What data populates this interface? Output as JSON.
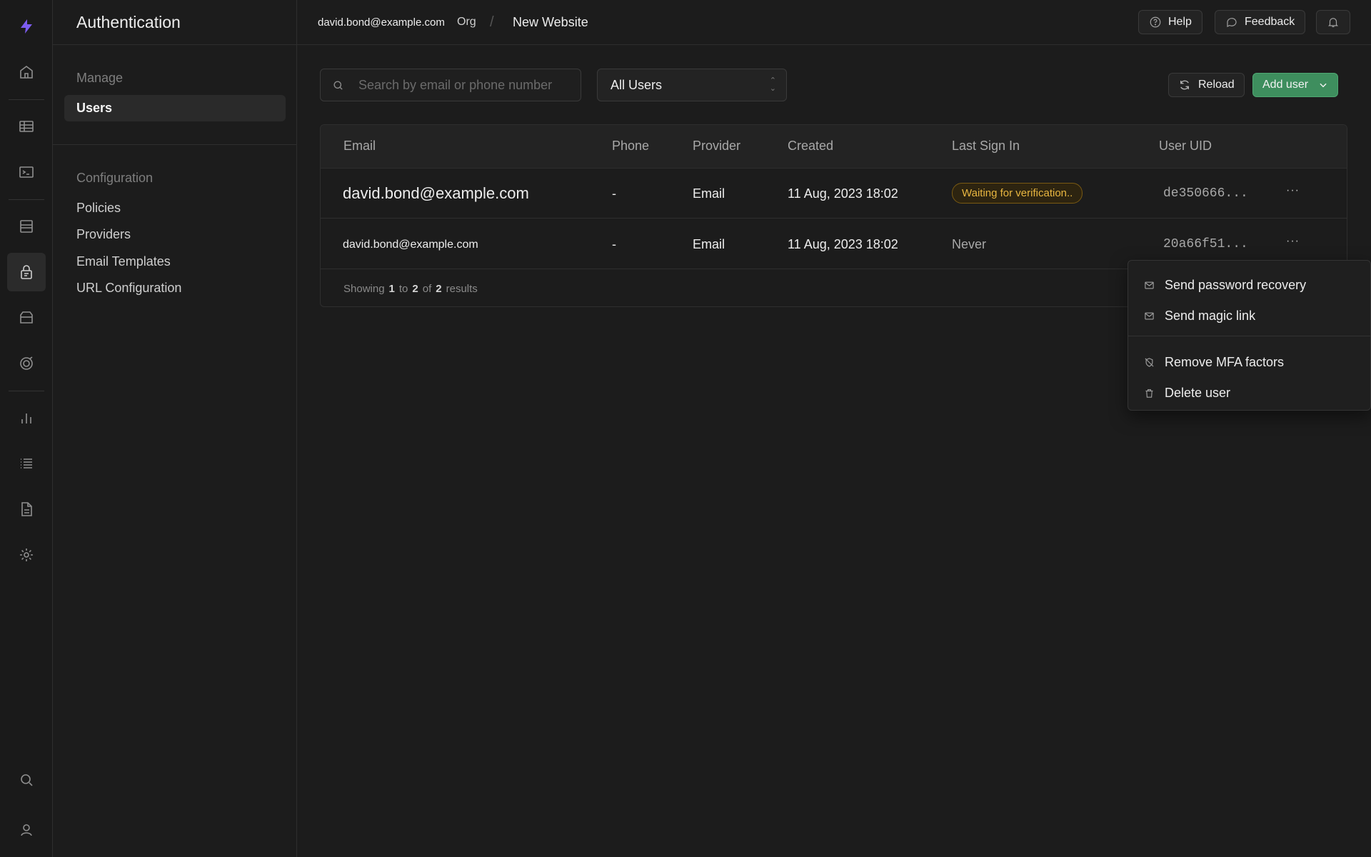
{
  "app": {
    "section_title": "Authentication"
  },
  "topbar": {
    "account_email": "david.bond@example.com",
    "org": "Org",
    "project": "New Website",
    "help_label": "Help",
    "feedback_label": "Feedback"
  },
  "sidebar": {
    "manage_label": "Manage",
    "manage_items": [
      {
        "label": "Users",
        "active": true
      }
    ],
    "config_label": "Configuration",
    "config_items": [
      {
        "label": "Policies"
      },
      {
        "label": "Providers"
      },
      {
        "label": "Email Templates"
      },
      {
        "label": "URL Configuration"
      }
    ]
  },
  "rail_icons": [
    "logo-icon",
    "home-icon",
    "table-editor-icon",
    "sql-editor-icon",
    "database-icon",
    "auth-icon",
    "storage-icon",
    "realtime-icon",
    "reports-icon",
    "logs-icon",
    "docs-icon",
    "settings-icon",
    "search-icon",
    "profile-icon"
  ],
  "toolbar": {
    "search_placeholder": "Search by email or phone number",
    "filter_value": "All Users",
    "reload_label": "Reload",
    "add_user_label": "Add user"
  },
  "table": {
    "columns": [
      "Email",
      "Phone",
      "Provider",
      "Created",
      "Last Sign In",
      "User UID"
    ],
    "rows": [
      {
        "email": "david.bond@example.com",
        "phone": "-",
        "provider": "Email",
        "created": "11 Aug, 2023 18:02",
        "last_sign_in": "Waiting for verification..",
        "uid": "de350666..."
      },
      {
        "email": "david.bond@example.com",
        "phone": "-",
        "provider": "Email",
        "created": "11 Aug, 2023 18:02",
        "last_sign_in": "Never",
        "uid": "20a66f51..."
      }
    ],
    "footer": {
      "showing": "Showing",
      "from": "1",
      "to_word": "to",
      "to": "2",
      "of_word": "of",
      "total": "2",
      "results": "results"
    }
  },
  "row_menu": {
    "items": [
      {
        "label": "Send password recovery",
        "icon": "mail-icon"
      },
      {
        "label": "Send magic link",
        "icon": "mail-icon"
      },
      {
        "label": "Remove MFA factors",
        "icon": "shield-off-icon"
      },
      {
        "label": "Delete user",
        "icon": "trash-icon"
      }
    ]
  },
  "colors": {
    "accent_green": "#3e8e5e",
    "badge_amber": "#e8b640",
    "logo_purple": "#7c5cf0",
    "background": "#1c1c1c"
  }
}
